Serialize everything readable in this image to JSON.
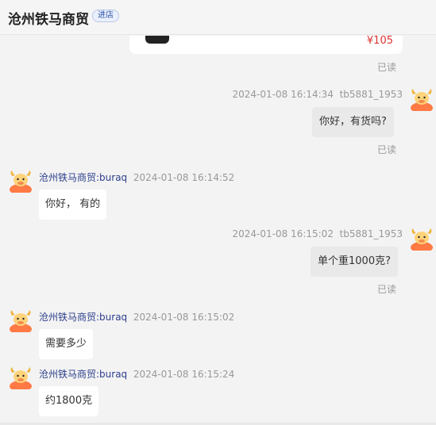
{
  "header": {
    "shop_name": "沧州铁马商贸",
    "enter_label": "进店"
  },
  "product": {
    "price": "¥105"
  },
  "messages": [
    {
      "dir": "out",
      "time": "2024-01-08 16:14:34",
      "user": "tb5881_1953",
      "text": "你好，有货吗?",
      "status": "已读"
    },
    {
      "dir": "in",
      "sender": "沧州铁马商贸:buraq",
      "time": "2024-01-08 16:14:52",
      "text": "你好， 有的"
    },
    {
      "dir": "out",
      "time": "2024-01-08 16:15:02",
      "user": "tb5881_1953",
      "text": "单个重1000克?",
      "status": "已读"
    },
    {
      "dir": "in",
      "sender": "沧州铁马商贸:buraq",
      "time": "2024-01-08 16:15:02",
      "text": "需要多少"
    },
    {
      "dir": "in",
      "sender": "沧州铁马商贸:buraq",
      "time": "2024-01-08 16:15:24",
      "text": "约1800克"
    }
  ],
  "first_read_status": "已读",
  "icons": {
    "avatar": "orange-bull-avatar-icon"
  },
  "colors": {
    "sender": "#2b3e8c",
    "price": "#e03030",
    "enter_badge": "#2c54a8"
  }
}
